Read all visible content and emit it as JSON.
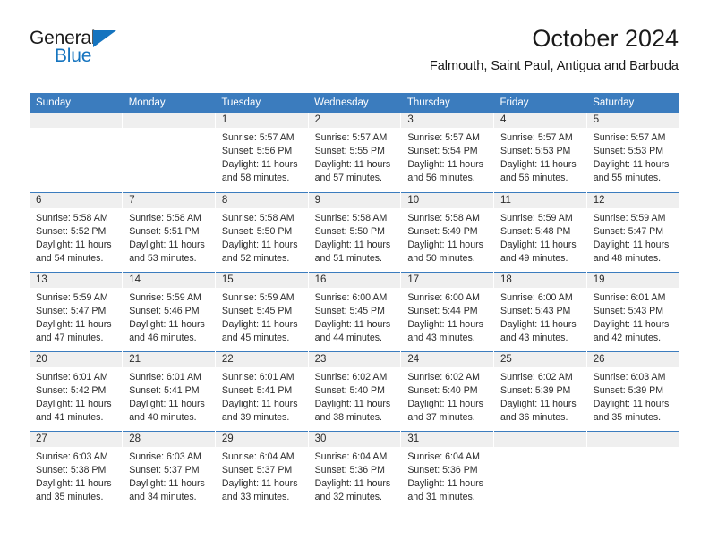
{
  "logo": {
    "primary_text": "General",
    "secondary_text": "Blue",
    "primary_color": "#1a1a1a",
    "accent_color": "#1574bf"
  },
  "header": {
    "title": "October 2024",
    "subtitle": "Falmouth, Saint Paul, Antigua and Barbuda"
  },
  "theme": {
    "header_blue": "#3b7cbe",
    "daynum_strip": "#efefef",
    "text": "#2b2b2b"
  },
  "calendar": {
    "weekday_headers": [
      "Sunday",
      "Monday",
      "Tuesday",
      "Wednesday",
      "Thursday",
      "Friday",
      "Saturday"
    ],
    "weeks": [
      [
        {
          "day": "",
          "empty": true
        },
        {
          "day": "",
          "empty": true
        },
        {
          "day": "1",
          "sunrise": "Sunrise: 5:57 AM",
          "sunset": "Sunset: 5:56 PM",
          "daylight": "Daylight: 11 hours and 58 minutes."
        },
        {
          "day": "2",
          "sunrise": "Sunrise: 5:57 AM",
          "sunset": "Sunset: 5:55 PM",
          "daylight": "Daylight: 11 hours and 57 minutes."
        },
        {
          "day": "3",
          "sunrise": "Sunrise: 5:57 AM",
          "sunset": "Sunset: 5:54 PM",
          "daylight": "Daylight: 11 hours and 56 minutes."
        },
        {
          "day": "4",
          "sunrise": "Sunrise: 5:57 AM",
          "sunset": "Sunset: 5:53 PM",
          "daylight": "Daylight: 11 hours and 56 minutes."
        },
        {
          "day": "5",
          "sunrise": "Sunrise: 5:57 AM",
          "sunset": "Sunset: 5:53 PM",
          "daylight": "Daylight: 11 hours and 55 minutes."
        }
      ],
      [
        {
          "day": "6",
          "sunrise": "Sunrise: 5:58 AM",
          "sunset": "Sunset: 5:52 PM",
          "daylight": "Daylight: 11 hours and 54 minutes."
        },
        {
          "day": "7",
          "sunrise": "Sunrise: 5:58 AM",
          "sunset": "Sunset: 5:51 PM",
          "daylight": "Daylight: 11 hours and 53 minutes."
        },
        {
          "day": "8",
          "sunrise": "Sunrise: 5:58 AM",
          "sunset": "Sunset: 5:50 PM",
          "daylight": "Daylight: 11 hours and 52 minutes."
        },
        {
          "day": "9",
          "sunrise": "Sunrise: 5:58 AM",
          "sunset": "Sunset: 5:50 PM",
          "daylight": "Daylight: 11 hours and 51 minutes."
        },
        {
          "day": "10",
          "sunrise": "Sunrise: 5:58 AM",
          "sunset": "Sunset: 5:49 PM",
          "daylight": "Daylight: 11 hours and 50 minutes."
        },
        {
          "day": "11",
          "sunrise": "Sunrise: 5:59 AM",
          "sunset": "Sunset: 5:48 PM",
          "daylight": "Daylight: 11 hours and 49 minutes."
        },
        {
          "day": "12",
          "sunrise": "Sunrise: 5:59 AM",
          "sunset": "Sunset: 5:47 PM",
          "daylight": "Daylight: 11 hours and 48 minutes."
        }
      ],
      [
        {
          "day": "13",
          "sunrise": "Sunrise: 5:59 AM",
          "sunset": "Sunset: 5:47 PM",
          "daylight": "Daylight: 11 hours and 47 minutes."
        },
        {
          "day": "14",
          "sunrise": "Sunrise: 5:59 AM",
          "sunset": "Sunset: 5:46 PM",
          "daylight": "Daylight: 11 hours and 46 minutes."
        },
        {
          "day": "15",
          "sunrise": "Sunrise: 5:59 AM",
          "sunset": "Sunset: 5:45 PM",
          "daylight": "Daylight: 11 hours and 45 minutes."
        },
        {
          "day": "16",
          "sunrise": "Sunrise: 6:00 AM",
          "sunset": "Sunset: 5:45 PM",
          "daylight": "Daylight: 11 hours and 44 minutes."
        },
        {
          "day": "17",
          "sunrise": "Sunrise: 6:00 AM",
          "sunset": "Sunset: 5:44 PM",
          "daylight": "Daylight: 11 hours and 43 minutes."
        },
        {
          "day": "18",
          "sunrise": "Sunrise: 6:00 AM",
          "sunset": "Sunset: 5:43 PM",
          "daylight": "Daylight: 11 hours and 43 minutes."
        },
        {
          "day": "19",
          "sunrise": "Sunrise: 6:01 AM",
          "sunset": "Sunset: 5:43 PM",
          "daylight": "Daylight: 11 hours and 42 minutes."
        }
      ],
      [
        {
          "day": "20",
          "sunrise": "Sunrise: 6:01 AM",
          "sunset": "Sunset: 5:42 PM",
          "daylight": "Daylight: 11 hours and 41 minutes."
        },
        {
          "day": "21",
          "sunrise": "Sunrise: 6:01 AM",
          "sunset": "Sunset: 5:41 PM",
          "daylight": "Daylight: 11 hours and 40 minutes."
        },
        {
          "day": "22",
          "sunrise": "Sunrise: 6:01 AM",
          "sunset": "Sunset: 5:41 PM",
          "daylight": "Daylight: 11 hours and 39 minutes."
        },
        {
          "day": "23",
          "sunrise": "Sunrise: 6:02 AM",
          "sunset": "Sunset: 5:40 PM",
          "daylight": "Daylight: 11 hours and 38 minutes."
        },
        {
          "day": "24",
          "sunrise": "Sunrise: 6:02 AM",
          "sunset": "Sunset: 5:40 PM",
          "daylight": "Daylight: 11 hours and 37 minutes."
        },
        {
          "day": "25",
          "sunrise": "Sunrise: 6:02 AM",
          "sunset": "Sunset: 5:39 PM",
          "daylight": "Daylight: 11 hours and 36 minutes."
        },
        {
          "day": "26",
          "sunrise": "Sunrise: 6:03 AM",
          "sunset": "Sunset: 5:39 PM",
          "daylight": "Daylight: 11 hours and 35 minutes."
        }
      ],
      [
        {
          "day": "27",
          "sunrise": "Sunrise: 6:03 AM",
          "sunset": "Sunset: 5:38 PM",
          "daylight": "Daylight: 11 hours and 35 minutes."
        },
        {
          "day": "28",
          "sunrise": "Sunrise: 6:03 AM",
          "sunset": "Sunset: 5:37 PM",
          "daylight": "Daylight: 11 hours and 34 minutes."
        },
        {
          "day": "29",
          "sunrise": "Sunrise: 6:04 AM",
          "sunset": "Sunset: 5:37 PM",
          "daylight": "Daylight: 11 hours and 33 minutes."
        },
        {
          "day": "30",
          "sunrise": "Sunrise: 6:04 AM",
          "sunset": "Sunset: 5:36 PM",
          "daylight": "Daylight: 11 hours and 32 minutes."
        },
        {
          "day": "31",
          "sunrise": "Sunrise: 6:04 AM",
          "sunset": "Sunset: 5:36 PM",
          "daylight": "Daylight: 11 hours and 31 minutes."
        },
        {
          "day": "",
          "empty": true
        },
        {
          "day": "",
          "empty": true
        }
      ]
    ]
  }
}
